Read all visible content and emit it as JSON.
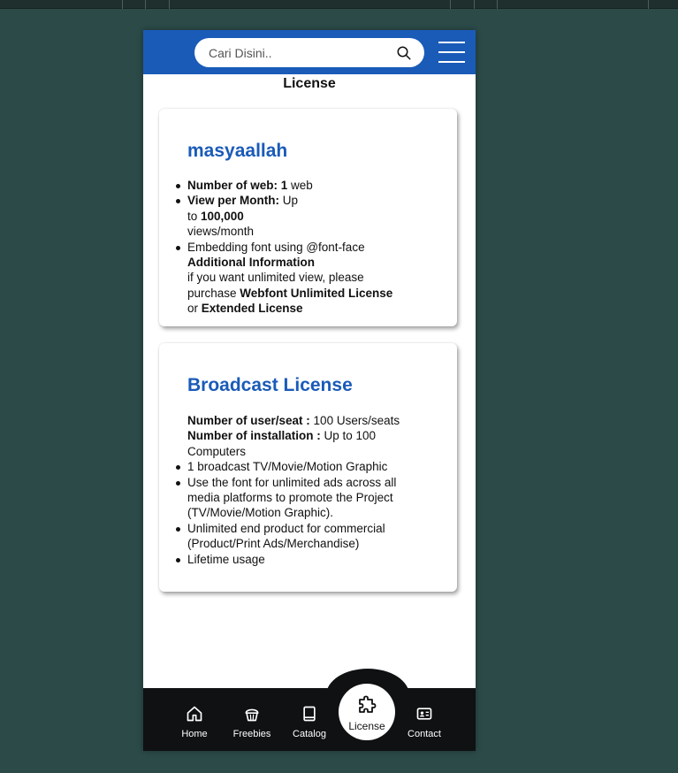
{
  "header": {
    "search_placeholder": "Cari Disini.."
  },
  "page_title": "License",
  "card1": {
    "title": "masyaallah",
    "web_label": "Number of web: ",
    "web_value": "1",
    "web_unit": " web",
    "view_label": "View per Month:",
    "view_pre": " Up to ",
    "view_value": "100,000",
    "view_unit": " views/month",
    "embed": "Embedding font using @font-face",
    "addl_title": "Additional Information",
    "addl_text": "if you want unlimited view, please purchase ",
    "webfont_unlimited": "Webfont Unlimited License",
    "or": " or ",
    "extended": "Extended License"
  },
  "card2": {
    "title": "Broadcast License",
    "seat_label": "Number of user/seat : ",
    "seat_value": "100 Users/seats",
    "install_label": "Number of installation : ",
    "install_value": "Up to 100 Computers",
    "items": [
      "1 broadcast TV/Movie/Motion Graphic",
      "Use the font for unlimited ads across all media platforms to promote the Project (TV/Movie/Motion Graphic).",
      "Unlimited end product for commercial (Product/Print Ads/Merchandise)",
      "Lifetime usage"
    ]
  },
  "nav": {
    "home": "Home",
    "freebies": "Freebies",
    "catalog": "Catalog",
    "license": "License",
    "contact": "Contact"
  },
  "colors": {
    "brand_blue": "#1a5bb8",
    "nav_bg": "#0f1112",
    "page_bg": "#2b4a48"
  }
}
